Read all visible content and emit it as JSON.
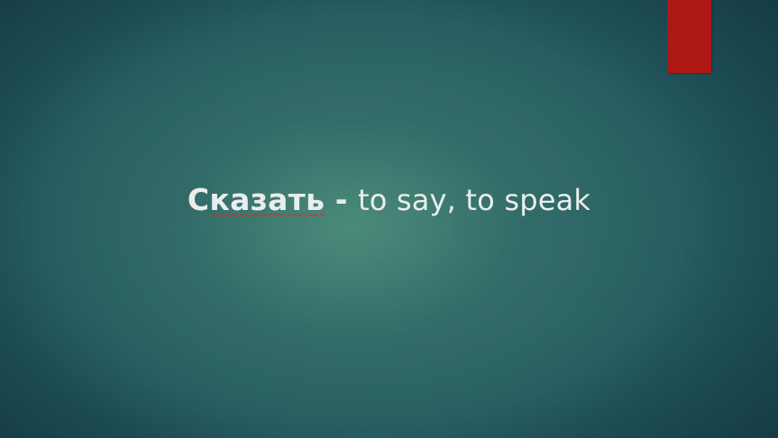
{
  "slide": {
    "accent_color": "#ad1714",
    "text_color": "#e9eeec",
    "word_initial": "С",
    "word_rest": "казать",
    "separator": " - ",
    "meaning": "to say, to speak"
  }
}
